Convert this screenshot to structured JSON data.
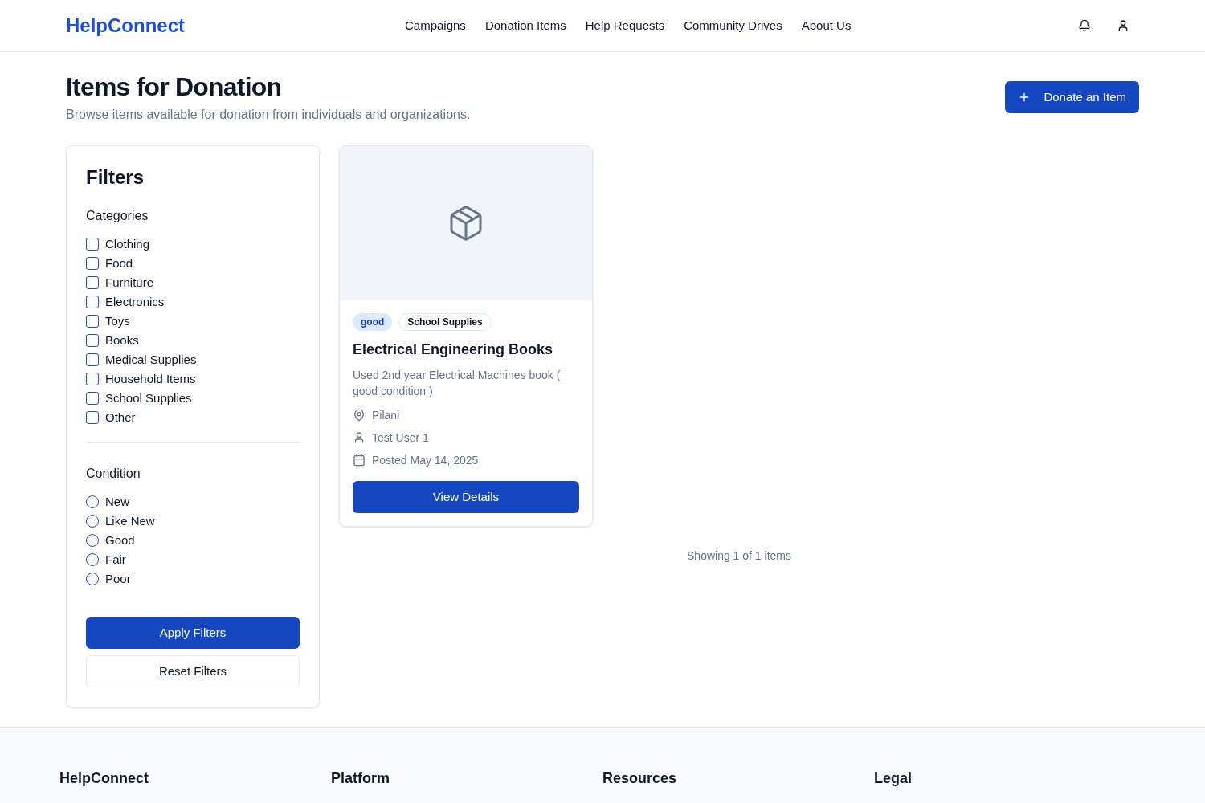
{
  "brand": "HelpConnect",
  "nav": [
    {
      "label": "Campaigns"
    },
    {
      "label": "Donation Items"
    },
    {
      "label": "Help Requests"
    },
    {
      "label": "Community Drives"
    },
    {
      "label": "About Us"
    }
  ],
  "page": {
    "title": "Items for Donation",
    "subtitle": "Browse items available for donation from individuals and organizations.",
    "action": "Donate an Item"
  },
  "filters": {
    "title": "Filters",
    "categories_title": "Categories",
    "categories": [
      {
        "label": "Clothing",
        "checked": false
      },
      {
        "label": "Food",
        "checked": false
      },
      {
        "label": "Furniture",
        "checked": false
      },
      {
        "label": "Electronics",
        "checked": false
      },
      {
        "label": "Toys",
        "checked": false
      },
      {
        "label": "Books",
        "checked": false
      },
      {
        "label": "Medical Supplies",
        "checked": false
      },
      {
        "label": "Household Items",
        "checked": false
      },
      {
        "label": "School Supplies",
        "checked": false
      },
      {
        "label": "Other",
        "checked": false
      }
    ],
    "condition_title": "Condition",
    "conditions": [
      {
        "label": "New",
        "selected": false
      },
      {
        "label": "Like New",
        "selected": false
      },
      {
        "label": "Good",
        "selected": false
      },
      {
        "label": "Fair",
        "selected": false
      },
      {
        "label": "Poor",
        "selected": false
      }
    ],
    "apply": "Apply Filters",
    "reset": "Reset Filters"
  },
  "items": [
    {
      "condition": "good",
      "category": "School Supplies",
      "title": "Electrical Engineering Books",
      "description": "Used 2nd year Electrical Machines book ( good condition )",
      "location": "Pilani",
      "user": "Test User 1",
      "posted": "Posted May 14, 2025",
      "button": "View Details"
    }
  ],
  "results": "Showing 1 of 1 items",
  "footer": {
    "columns": [
      {
        "title": "HelpConnect"
      },
      {
        "title": "Platform"
      },
      {
        "title": "Resources"
      },
      {
        "title": "Legal"
      }
    ]
  }
}
